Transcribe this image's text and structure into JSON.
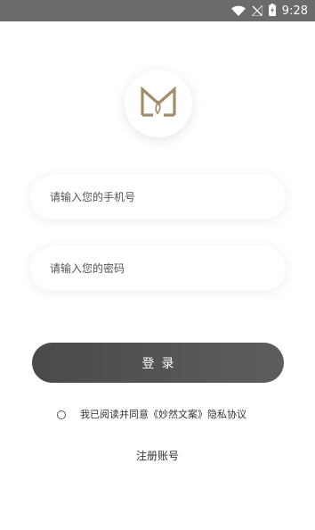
{
  "status_bar": {
    "time": "9:28",
    "icons": [
      "wifi-icon",
      "no-signal-icon",
      "battery-charging-icon"
    ]
  },
  "logo": {
    "icon": "brand-m-logo-icon",
    "color": "#a38c68"
  },
  "phone_field": {
    "placeholder": "请输入您的手机号",
    "value": ""
  },
  "password_field": {
    "placeholder": "请输入您的密码",
    "value": ""
  },
  "login_button": {
    "label": "登录"
  },
  "agreement": {
    "checked": false,
    "text": "我已阅读并同意《妙然文案》隐私协议"
  },
  "register": {
    "label": "注册账号"
  },
  "colors": {
    "status_bar": "#6b6b6b",
    "button": "#4a4a4a",
    "logo_gold": "#a38c68",
    "text": "#333333"
  }
}
